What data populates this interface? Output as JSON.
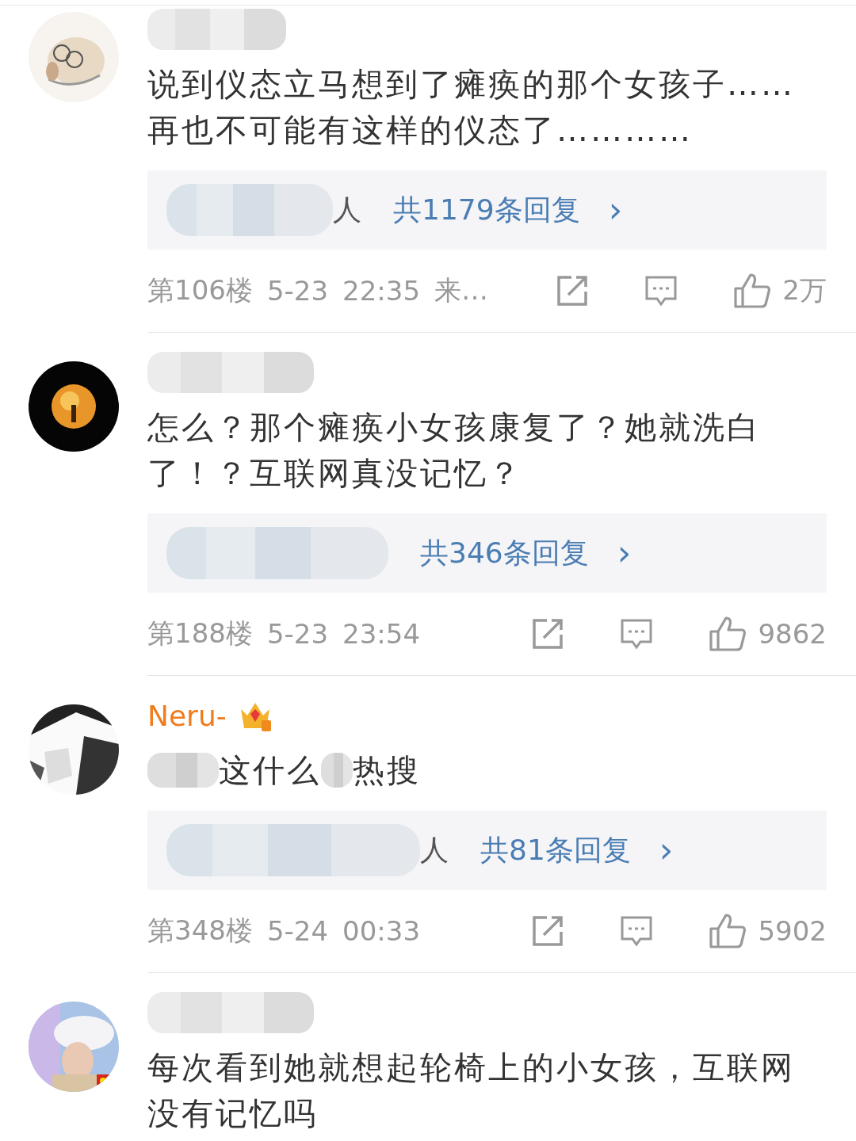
{
  "comments": [
    {
      "user": {
        "kind": "blurred"
      },
      "body": [
        {
          "kind": "text",
          "text": "说到仪态立马想到了瘫痪的那个女孩子……\n再也不可能有这样的仪态了…………"
        }
      ],
      "reply": {
        "suffix": "人",
        "count": "共1179条回复",
        "arrow": "›"
      },
      "footer": {
        "floor": "第106楼",
        "date": "5-23",
        "time": "22:35",
        "source": "来…",
        "likes": "2万"
      }
    },
    {
      "user": {
        "kind": "blurred"
      },
      "body": [
        {
          "kind": "text",
          "text": "怎么？那个瘫痪小女孩康复了？她就洗白了！？互联网真没记忆？"
        }
      ],
      "reply": {
        "count": "共346条回复",
        "arrow": "›"
      },
      "footer": {
        "floor": "第188楼",
        "date": "5-23",
        "time": "23:54",
        "likes": "9862"
      }
    },
    {
      "user": {
        "kind": "named",
        "name": "Neru-",
        "badge": true
      },
      "body": [
        {
          "kind": "blur"
        },
        {
          "kind": "text",
          "text": "这什么"
        },
        {
          "kind": "blur"
        },
        {
          "kind": "text",
          "text": "热搜"
        }
      ],
      "reply": {
        "suffix": "人",
        "count": "共81条回复",
        "arrow": "›"
      },
      "footer": {
        "floor": "第348楼",
        "date": "5-24",
        "time": "00:33",
        "likes": "5902"
      }
    },
    {
      "user": {
        "kind": "blurred"
      },
      "body": [
        {
          "kind": "text",
          "text": "每次看到她就想起轮椅上的小女孩，互联网没有记忆吗"
        }
      ]
    }
  ]
}
